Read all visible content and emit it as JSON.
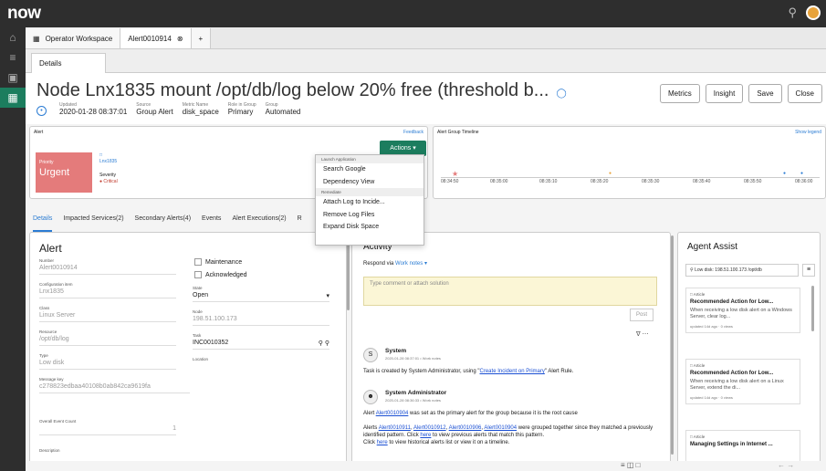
{
  "brand": "now",
  "tabs": [
    {
      "label": "Operator Workspace"
    },
    {
      "label": "Alert0010914"
    }
  ],
  "subtab": "Details",
  "header": {
    "title": "Node Lnx1835 mount /opt/db/log below 20% free (threshold b...",
    "meta": [
      {
        "label": "Updated",
        "value": "2020-01-28 08:37:01"
      },
      {
        "label": "Source",
        "value": "Group Alert"
      },
      {
        "label": "Metric Name",
        "value": "disk_space"
      },
      {
        "label": "Role in Group",
        "value": "Primary"
      },
      {
        "label": "Group",
        "value": "Automated"
      }
    ],
    "buttons": [
      "Metrics",
      "Insight",
      "Save",
      "Close"
    ]
  },
  "alert_panel": {
    "title": "Alert",
    "feedback": "Feedback",
    "priority_label": "Priority",
    "priority_value": "Urgent",
    "ci": "Lnx1835",
    "severity_label": "Severity",
    "severity_value": "Critical",
    "actions": "Actions"
  },
  "actions_menu": {
    "section1": "Launch Application",
    "items1": [
      "Search Google",
      "Dependency View"
    ],
    "section2": "Remediate",
    "items2": [
      "Attach Log to Incide...",
      "Remove Log Files",
      "Expand Disk Space"
    ]
  },
  "timeline": {
    "title": "Alert Group Timeline",
    "show_legend": "Show legend",
    "ticks": [
      "08:34:50",
      "08:35:00",
      "08:35:10",
      "08:35:20",
      "08:35:30",
      "08:35:40",
      "08:35:50",
      "08:36:00"
    ]
  },
  "record_tabs": [
    "Details",
    "Impacted Services(2)",
    "Secondary Alerts(4)",
    "Events",
    "Alert Executions(2)",
    "R"
  ],
  "form": {
    "title": "Alert",
    "number_label": "Number",
    "number": "Alert0010914",
    "ci_label": "Configuration item",
    "ci": "Lnx1835",
    "class_label": "Class",
    "class": "Linux Server",
    "resource_label": "Resource",
    "resource": "/opt/db/log",
    "type_label": "Type",
    "type": "Low disk",
    "key_label": "Message key",
    "key": "c278823edbaa40108b0ab842ca9619fa",
    "count_label": "Overall Event Count",
    "count": "1",
    "desc_label": "Description",
    "maintenance": "Maintenance",
    "acknowledged": "Acknowledged",
    "state_label": "State",
    "state": "Open",
    "node_label": "Node",
    "node": "198.51.100.173",
    "task_label": "Task",
    "task": "INC0010352",
    "location_label": "Location"
  },
  "activity": {
    "title": "Activity",
    "respond_prefix": "Respond via",
    "respond_mode": "Work notes",
    "placeholder": "Type comment or attach solution",
    "post": "Post",
    "e1_who": "System",
    "e1_when": "2020-01-28 08:37:01 • Work notes",
    "e1_text_a": "Task is created by System Administrator, using \"",
    "e1_link": "Create Incident on Primary",
    "e1_text_b": "\" Alert Rule.",
    "e2_who": "System Administrator",
    "e2_when": "2020-01-28 08:36:33 • Work notes",
    "e2_p1_a": "Alert ",
    "e2_p1_link": "Alert0010904",
    "e2_p1_b": " was set as the primary alert for the group because it is the root cause",
    "e2_p2_a": "Alerts ",
    "e2_p2_l1": "Alert0010911",
    "e2_p2_l2": "Alert0010912",
    "e2_p2_l3": "Alert0010906",
    "e2_p2_l4": "Alert0010904",
    "e2_p2_b": " were grouped together since they matched a previously identified pattern. Click ",
    "e2_p2_here": "here",
    "e2_p2_c": " to view previous alerts that match this pattern.",
    "e2_p3_a": "Click ",
    "e2_p3_here": "here",
    "e2_p3_b": " to view historical alerts list or view it on a timeline."
  },
  "agent": {
    "title": "Agent Assist",
    "search": "Low disk: 198.51.100.173 /opt/db",
    "cards": [
      {
        "type": "Article",
        "title": "Recommended Action for Low...",
        "body": "When receiving a low disk alert on a Windows Server, clear log...",
        "meta": "updated 14d ago · 0 views"
      },
      {
        "type": "Article",
        "title": "Recommended Action for Low...",
        "body": "When receiving a low disk alert on a Linux Server, extend the di...",
        "meta": "updated 14d ago · 0 views"
      },
      {
        "type": "Article",
        "title": "Managing Settings in Internet ...",
        "body": "",
        "meta": ""
      }
    ]
  },
  "colors": {
    "accent": "#1c7d5e",
    "urgent": "#e47b7b",
    "link": "#2b7cd3"
  }
}
